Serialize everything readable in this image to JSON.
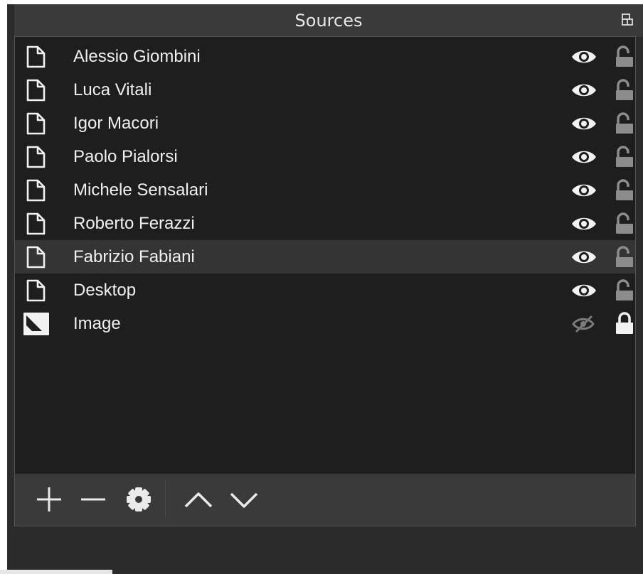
{
  "dock": {
    "title": "Sources"
  },
  "sources": [
    {
      "name": "Alessio Giombini",
      "type": "file",
      "visible": true,
      "locked": false,
      "selected": false
    },
    {
      "name": "Luca Vitali",
      "type": "file",
      "visible": true,
      "locked": false,
      "selected": false
    },
    {
      "name": "Igor Macori",
      "type": "file",
      "visible": true,
      "locked": false,
      "selected": false
    },
    {
      "name": "Paolo Pialorsi",
      "type": "file",
      "visible": true,
      "locked": false,
      "selected": false
    },
    {
      "name": "Michele Sensalari",
      "type": "file",
      "visible": true,
      "locked": false,
      "selected": false
    },
    {
      "name": "Roberto Ferazzi",
      "type": "file",
      "visible": true,
      "locked": false,
      "selected": false
    },
    {
      "name": "Fabrizio Fabiani",
      "type": "file",
      "visible": true,
      "locked": false,
      "selected": true
    },
    {
      "name": "Desktop",
      "type": "file",
      "visible": true,
      "locked": false,
      "selected": false
    },
    {
      "name": "Image",
      "type": "image",
      "visible": false,
      "locked": true,
      "selected": false
    }
  ],
  "toolbar": {
    "buttons": [
      "plus-icon",
      "minus-icon",
      "gear-icon",
      "chevron-up-icon",
      "chevron-down-icon"
    ]
  },
  "colors": {
    "panel_bg": "#1e1e1e",
    "selected_row": "#343434",
    "title_bar": "#3a3a3a",
    "toolbar": "#3a3a3a",
    "text": "#f0f0f0",
    "icon_gray": "#8c8c8c"
  }
}
